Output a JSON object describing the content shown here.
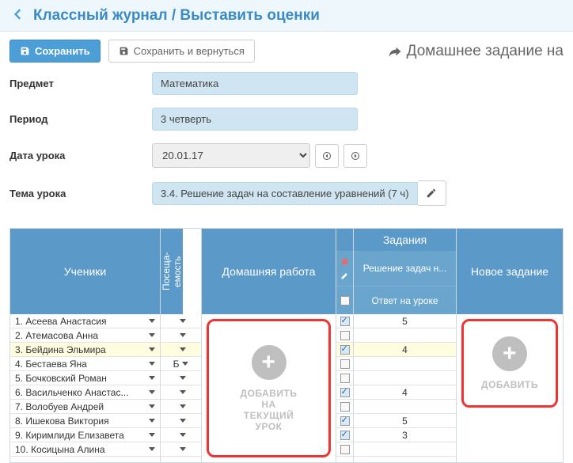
{
  "header": {
    "title": "Классный журнал / Выставить оценки"
  },
  "toolbar": {
    "save": "Сохранить",
    "save_back": "Сохранить и вернуться",
    "homework_link": "Домашнее задание на"
  },
  "form": {
    "subject_label": "Предмет",
    "subject_value": "Математика",
    "period_label": "Период",
    "period_value": "3 четверть",
    "date_label": "Дата урока",
    "date_value": "20.01.17",
    "topic_label": "Тема урока",
    "topic_value": "3.4. Решение задач на составление уравнений (7 ч)"
  },
  "grid": {
    "students_header": "Ученики",
    "attendance_header": "Посеща-\nемость",
    "homework_header": "Домашняя работа",
    "tasks_header": "Задания",
    "task_title": "Решение задач н...",
    "task_sub": "Ответ на уроке",
    "new_task_header": "Новое задание",
    "add_hw": "ДОБАВИТЬ\nНА\nТЕКУЩИЙ\nУРОК",
    "add_new": "ДОБАВИТЬ",
    "students": [
      {
        "n": "1. Асеева Анастасия",
        "att": "",
        "chk": true,
        "mark": "5",
        "hl": false
      },
      {
        "n": "2. Атемасова Анна",
        "att": "",
        "chk": false,
        "mark": "",
        "hl": false
      },
      {
        "n": "3. Бейдина Эльмира",
        "att": "",
        "chk": true,
        "mark": "4",
        "hl": true
      },
      {
        "n": "4. Бестаева Яна",
        "att": "Б",
        "chk": false,
        "mark": "",
        "hl": false
      },
      {
        "n": "5. Бочковский Роман",
        "att": "",
        "chk": false,
        "mark": "",
        "hl": false
      },
      {
        "n": "6. Васильченко Анастас...",
        "att": "",
        "chk": true,
        "mark": "4",
        "hl": false
      },
      {
        "n": "7. Волобуев Андрей",
        "att": "",
        "chk": false,
        "mark": "",
        "hl": false
      },
      {
        "n": "8. Ишекова Виктория",
        "att": "",
        "chk": true,
        "mark": "5",
        "hl": false
      },
      {
        "n": "9. Киримлиди Елизавета",
        "att": "",
        "chk": true,
        "mark": "3",
        "hl": false
      },
      {
        "n": "10. Косицына Алина",
        "att": "",
        "chk": false,
        "mark": "",
        "hl": false
      }
    ]
  }
}
